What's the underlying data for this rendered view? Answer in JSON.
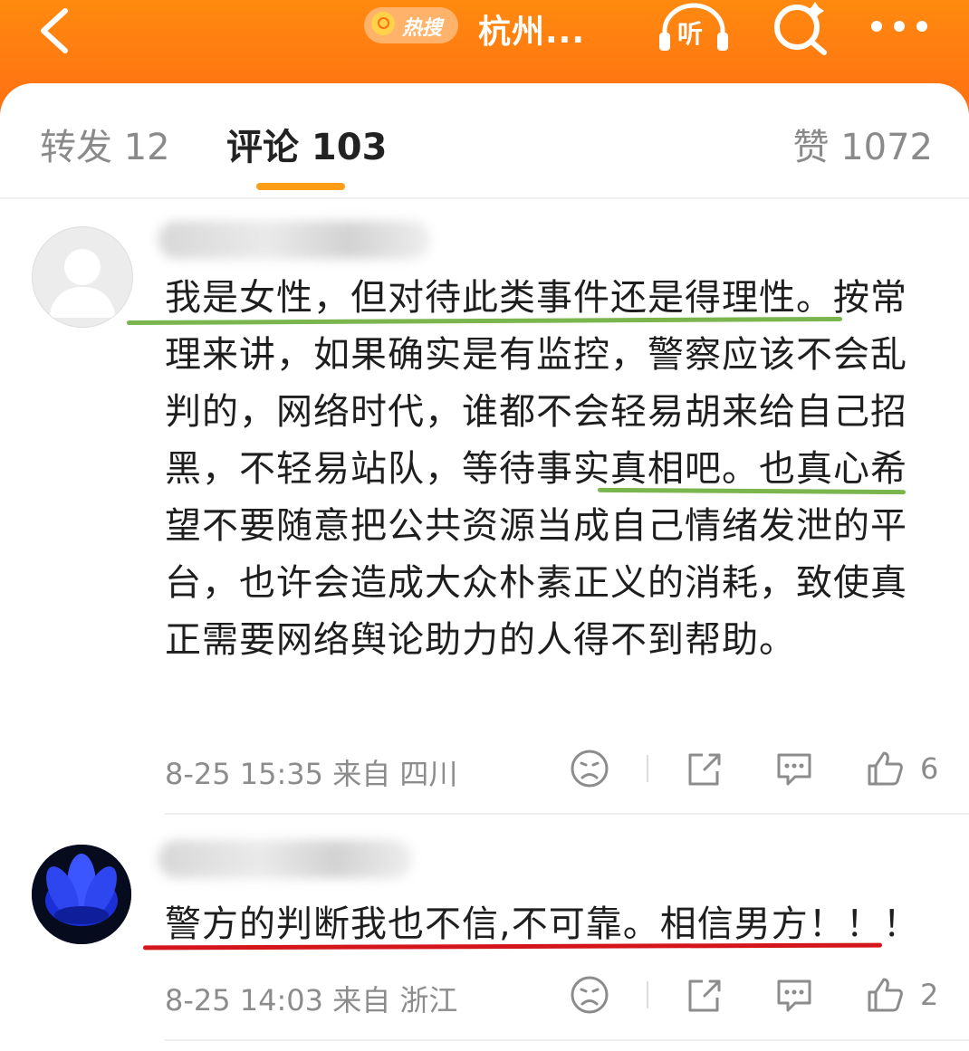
{
  "header": {
    "hot_label": "热搜",
    "title": "杭州...",
    "listen_label": "听"
  },
  "tabs": {
    "repost": "转发 12",
    "comment": "评论 103",
    "like": "赞 1072"
  },
  "comments": [
    {
      "text": "我是女性，但对待此类事件还是得理性。按常理来讲，如果确实是有监控，警察应该不会乱判的，网络时代，谁都不会轻易胡来给自己招黑，不轻易站队，等待事实真相吧。也真心希望不要随意把公共资源当成自己情绪发泄的平台，也许会造成大众朴素正义的消耗，致使真正需要网络舆论助力的人得不到帮助。",
      "meta": "8-25 15:35 来自 四川",
      "likes": "6"
    },
    {
      "text": "警方的判断我也不信,不可靠。相信男方！！！",
      "meta": "8-25 14:03 来自 浙江",
      "likes": "2"
    }
  ],
  "colors": {
    "header_orange": "#ff7a12",
    "tab_accent": "#ff9d17",
    "green_underline": "#7ab54e",
    "red_underline": "#d4151b"
  }
}
